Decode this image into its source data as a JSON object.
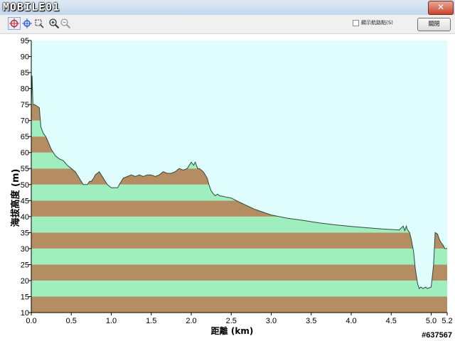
{
  "window": {
    "brand": "MOBILE01",
    "close_symbol": "✕"
  },
  "toolbar": {
    "tools": [
      "crosshair-select-icon",
      "crosshair-icon",
      "lasso-zoom-icon",
      "zoom-in-icon",
      "zoom-out-icon"
    ],
    "checkbox_label": "顯示航路點(S)",
    "checkbox_checked": false,
    "close_button": "關閉"
  },
  "watermark": "#637567",
  "chart_data": {
    "type": "area",
    "title": "",
    "xlabel": "距離  (km)",
    "ylabel": "海拔高度 (m)",
    "xlim": [
      0,
      5.2
    ],
    "ylim": [
      10,
      95
    ],
    "x_ticks": [
      "0.0",
      "0.5",
      "1.0",
      "1.5",
      "2.0",
      "2.5",
      "3.0",
      "3.5",
      "4.0",
      "4.5",
      "5.0",
      "5.2"
    ],
    "y_ticks": [
      "10",
      "15",
      "20",
      "25",
      "30",
      "35",
      "40",
      "45",
      "50",
      "55",
      "60",
      "65",
      "70",
      "75",
      "80",
      "85",
      "90",
      "95"
    ],
    "band_colors": [
      "#b58d62",
      "#9eefbd"
    ],
    "sky_color": "#dffdfd",
    "series": [
      {
        "x": [
          0.0,
          0.01,
          0.02,
          0.03,
          0.04,
          0.1,
          0.12,
          0.15,
          0.18,
          0.2,
          0.25,
          0.3,
          0.35,
          0.4,
          0.45,
          0.5,
          0.55,
          0.6,
          0.65,
          0.7,
          0.73,
          0.75,
          0.78,
          0.8,
          0.85,
          0.9,
          0.95,
          1.0,
          1.05,
          1.08,
          1.1,
          1.15,
          1.2,
          1.25,
          1.3,
          1.35,
          1.4,
          1.45,
          1.5,
          1.55,
          1.6,
          1.65,
          1.7,
          1.75,
          1.8,
          1.85,
          1.9,
          1.95,
          2.0,
          2.03,
          2.05,
          2.08,
          2.1,
          2.15,
          2.2,
          2.22,
          2.25,
          2.28,
          2.3,
          2.33,
          2.35,
          2.4,
          2.45,
          2.5,
          2.6,
          2.8,
          3.0,
          3.2,
          3.4,
          3.6,
          3.8,
          4.0,
          4.2,
          4.4,
          4.6,
          4.65,
          4.67,
          4.69,
          4.7,
          4.73,
          4.75,
          4.78,
          4.8,
          4.83,
          4.85,
          4.87,
          4.9,
          4.93,
          4.95,
          5.0,
          5.03,
          5.05,
          5.08,
          5.1,
          5.12,
          5.15,
          5.17,
          5.2
        ],
        "y": [
          75,
          84,
          75,
          75,
          75,
          74,
          68,
          66,
          65,
          64,
          61,
          59,
          58,
          57.5,
          56,
          55,
          54,
          52,
          50,
          50,
          51,
          51,
          52,
          53,
          54,
          52,
          50,
          49,
          49,
          49,
          50,
          52,
          52.5,
          53,
          52.5,
          53,
          52.5,
          53,
          53,
          52.5,
          53,
          54,
          53.5,
          53.5,
          54,
          55,
          54.5,
          55,
          57,
          56,
          57,
          55,
          55,
          54,
          52,
          50,
          48,
          47,
          46.5,
          47,
          46.5,
          46.3,
          46,
          45.8,
          44.5,
          42.2,
          40.5,
          39.5,
          38.8,
          38,
          37.4,
          36.9,
          36.5,
          36.1,
          35.8,
          37,
          35.6,
          37,
          36,
          35,
          33,
          29,
          24,
          19,
          17.5,
          18,
          17.5,
          18,
          17.5,
          18,
          25,
          35,
          34.5,
          33,
          32,
          31,
          30,
          30
        ]
      }
    ]
  }
}
